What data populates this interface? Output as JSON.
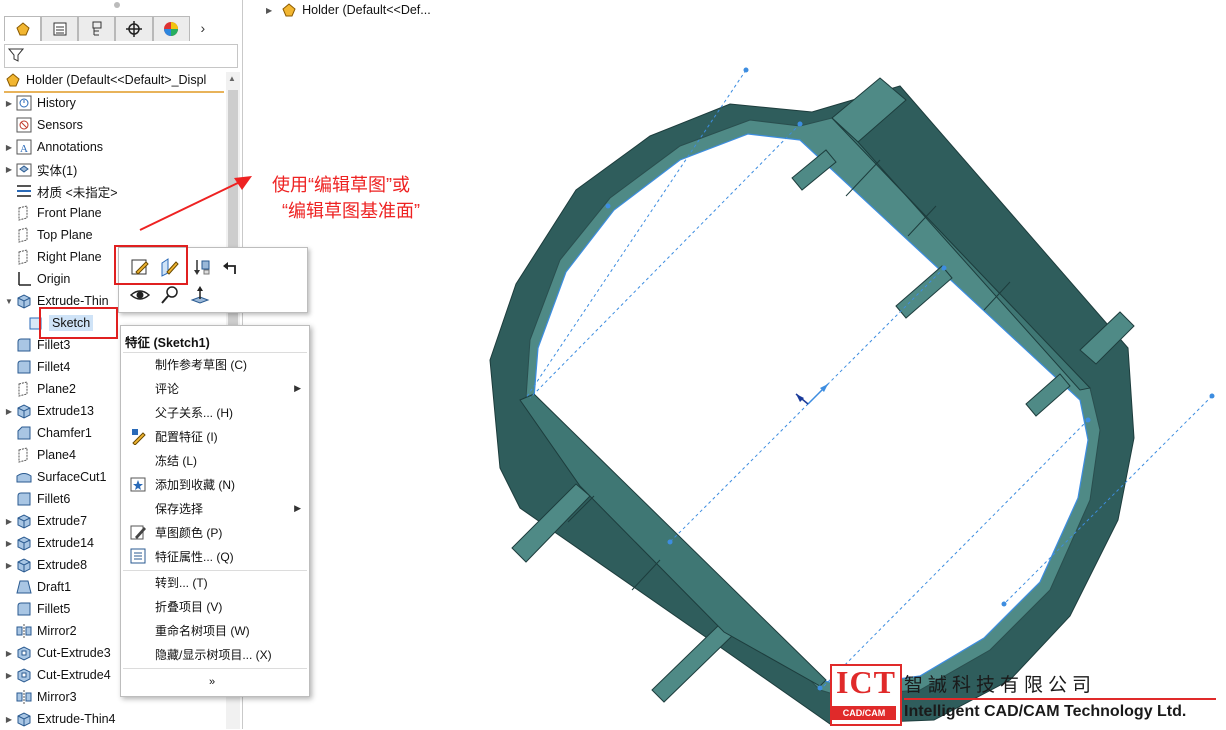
{
  "window": {
    "model_title": "Holder  (Default<<Def..."
  },
  "feature_tree": {
    "root_label": "Holder  (Default<<Default>_Displ",
    "items": [
      {
        "label": "History",
        "expandable": true,
        "icon": "history-icon"
      },
      {
        "label": "Sensors",
        "expandable": false,
        "icon": "sensors-icon"
      },
      {
        "label": "Annotations",
        "expandable": true,
        "icon": "annotations-icon"
      },
      {
        "label": "实体(1)",
        "expandable": true,
        "icon": "solid-bodies-icon"
      },
      {
        "label": "材质 <未指定>",
        "expandable": false,
        "icon": "material-icon"
      },
      {
        "label": "Front Plane",
        "expandable": false,
        "icon": "plane-icon"
      },
      {
        "label": "Top Plane",
        "expandable": false,
        "icon": "plane-icon"
      },
      {
        "label": "Right Plane",
        "expandable": false,
        "icon": "plane-icon"
      },
      {
        "label": "Origin",
        "expandable": false,
        "icon": "origin-icon"
      },
      {
        "label": "Extrude-Thin",
        "expandable": true,
        "expanded": true,
        "icon": "extrude-icon"
      },
      {
        "label": "Sketch",
        "expandable": false,
        "icon": "sketch-icon",
        "child": true,
        "selected": true
      },
      {
        "label": "Fillet3",
        "expandable": false,
        "icon": "fillet-icon"
      },
      {
        "label": "Fillet4",
        "expandable": false,
        "icon": "fillet-icon"
      },
      {
        "label": "Plane2",
        "expandable": false,
        "icon": "plane-icon"
      },
      {
        "label": "Extrude13",
        "expandable": true,
        "icon": "extrude-icon"
      },
      {
        "label": "Chamfer1",
        "expandable": false,
        "icon": "chamfer-icon"
      },
      {
        "label": "Plane4",
        "expandable": false,
        "icon": "plane-icon"
      },
      {
        "label": "SurfaceCut1",
        "expandable": false,
        "icon": "surface-cut-icon"
      },
      {
        "label": "Fillet6",
        "expandable": false,
        "icon": "fillet-icon"
      },
      {
        "label": "Extrude7",
        "expandable": true,
        "icon": "extrude-icon"
      },
      {
        "label": "Extrude14",
        "expandable": true,
        "icon": "extrude-icon"
      },
      {
        "label": "Extrude8",
        "expandable": true,
        "icon": "extrude-icon"
      },
      {
        "label": "Draft1",
        "expandable": false,
        "icon": "draft-icon"
      },
      {
        "label": "Fillet5",
        "expandable": false,
        "icon": "fillet-icon"
      },
      {
        "label": "Mirror2",
        "expandable": false,
        "icon": "mirror-icon"
      },
      {
        "label": "Cut-Extrude3",
        "expandable": true,
        "icon": "cut-extrude-icon"
      },
      {
        "label": "Cut-Extrude4",
        "expandable": true,
        "icon": "cut-extrude-icon"
      },
      {
        "label": "Mirror3",
        "expandable": false,
        "icon": "mirror-icon"
      },
      {
        "label": "Extrude-Thin4",
        "expandable": true,
        "icon": "extrude-icon"
      }
    ]
  },
  "annotation": {
    "line1": "使用“编辑草图”或",
    "line2": "“编辑草图基准面”",
    "color": "#ee2222"
  },
  "context_toolbar": {
    "buttons": [
      "edit-sketch-icon",
      "edit-sketch-plane-icon",
      "select-other-icon",
      "back-arrow-icon",
      "show-hide-icon",
      "zoom-to-selection-icon",
      "normal-to-icon"
    ]
  },
  "context_menu": {
    "title": "特征 (Sketch1)",
    "items": [
      {
        "label": "制作参考草图 (C)",
        "submenu": false,
        "icon": ""
      },
      {
        "label": "评论",
        "submenu": true,
        "icon": ""
      },
      {
        "label": "父子关系... (H)",
        "submenu": false,
        "icon": ""
      },
      {
        "label": "配置特征 (I)",
        "submenu": false,
        "icon": "configure-feature-icon"
      },
      {
        "label": "冻结 (L)",
        "submenu": false,
        "icon": ""
      },
      {
        "label": "添加到收藏 (N)",
        "submenu": false,
        "icon": "favorite-icon"
      },
      {
        "label": "保存选择",
        "submenu": true,
        "icon": ""
      },
      {
        "label": "草图颜色 (P)",
        "submenu": false,
        "icon": "sketch-color-icon"
      },
      {
        "label": "特征属性... (Q)",
        "submenu": false,
        "icon": "feature-properties-icon"
      },
      {
        "label": "转到... (T)",
        "submenu": false,
        "icon": ""
      },
      {
        "label": "折叠项目 (V)",
        "submenu": false,
        "icon": ""
      },
      {
        "label": "重命名树项目 (W)",
        "submenu": false,
        "icon": ""
      },
      {
        "label": "隐藏/显示树项目... (X)",
        "submenu": false,
        "icon": ""
      }
    ],
    "more": "»"
  },
  "watermark": {
    "logo_text": "ICT",
    "logo_sub": "CAD/CAM",
    "company_cn": "智誠科技有限公司",
    "company_en": "Intelligent CAD/CAM Technology Ltd."
  },
  "colors": {
    "model_face": "#4f8a86",
    "model_dark": "#2f5d5c",
    "sketch_line": "#3d8de0",
    "accent": "#e02020"
  }
}
